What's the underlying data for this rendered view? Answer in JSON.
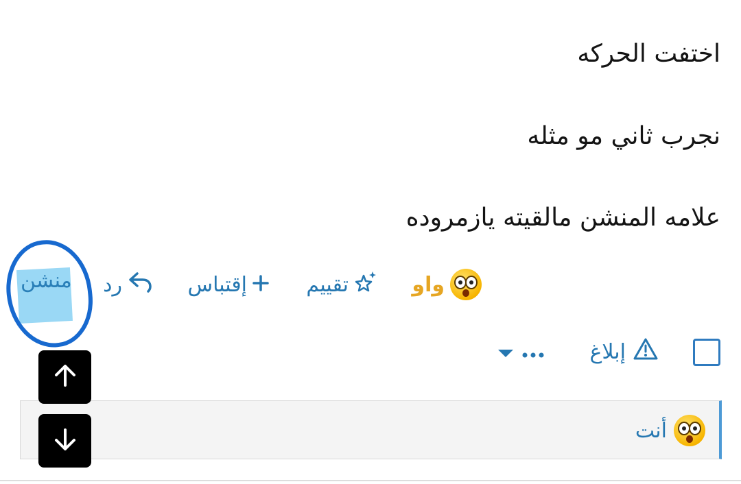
{
  "message": {
    "lines": [
      "اختفت الحركه",
      "نجرب ثاني مو مثله",
      "علامه المنشن مالقيته يازمروده"
    ]
  },
  "actions": {
    "wow_label": "واو",
    "wow_icon": "astonished-face-emoji",
    "rate_label": "تقييم",
    "rate_icon": "sparkle-star-icon",
    "quote_label": "إقتباس",
    "quote_icon": "plus-icon",
    "reply_label": "رد",
    "reply_icon": "reply-arrow-icon",
    "mention_label": "منشن"
  },
  "secondary": {
    "report_label": "إبلاغ",
    "report_icon": "warning-icon",
    "more_icon": "ellipsis-icon",
    "dropdown_icon": "caret-down-icon",
    "checkbox_icon": "checkbox-icon"
  },
  "reactions": {
    "emoji": "astonished-face-emoji",
    "label": "أنت"
  },
  "scroll": {
    "up_icon": "arrow-up-icon",
    "down_icon": "arrow-down-icon"
  },
  "colors": {
    "link": "#2577b1",
    "wow": "#e6a623",
    "highlight": "#9ad8f5",
    "circle": "#1769cf"
  }
}
